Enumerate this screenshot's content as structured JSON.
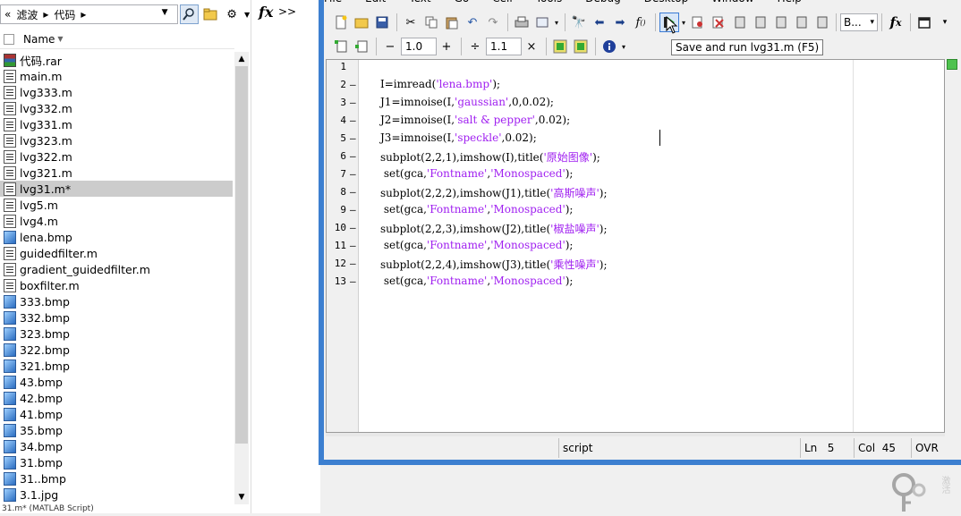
{
  "file_browser": {
    "breadcrumb": [
      "«",
      "滤波",
      "▸",
      "代码",
      "▸"
    ],
    "column_header": "Name",
    "files": [
      {
        "name": "代码.rar",
        "type": "rar"
      },
      {
        "name": "main.m",
        "type": "m"
      },
      {
        "name": "lvg333.m",
        "type": "m"
      },
      {
        "name": "lvg332.m",
        "type": "m"
      },
      {
        "name": "lvg331.m",
        "type": "m"
      },
      {
        "name": "lvg323.m",
        "type": "m"
      },
      {
        "name": "lvg322.m",
        "type": "m"
      },
      {
        "name": "lvg321.m",
        "type": "m"
      },
      {
        "name": "lvg31.m*",
        "type": "m",
        "selected": true
      },
      {
        "name": "lvg5.m",
        "type": "m"
      },
      {
        "name": "lvg4.m",
        "type": "m"
      },
      {
        "name": "lena.bmp",
        "type": "img"
      },
      {
        "name": "guidedfilter.m",
        "type": "m"
      },
      {
        "name": "gradient_guidedfilter.m",
        "type": "m"
      },
      {
        "name": "boxfilter.m",
        "type": "m"
      },
      {
        "name": "333.bmp",
        "type": "img"
      },
      {
        "name": "332.bmp",
        "type": "img"
      },
      {
        "name": "323.bmp",
        "type": "img"
      },
      {
        "name": "322.bmp",
        "type": "img"
      },
      {
        "name": "321.bmp",
        "type": "img"
      },
      {
        "name": "43.bmp",
        "type": "img"
      },
      {
        "name": "42.bmp",
        "type": "img"
      },
      {
        "name": "41.bmp",
        "type": "img"
      },
      {
        "name": "35.bmp",
        "type": "img"
      },
      {
        "name": "34.bmp",
        "type": "img"
      },
      {
        "name": "31.bmp",
        "type": "img"
      },
      {
        "name": "31..bmp",
        "type": "img"
      },
      {
        "name": "3.1.jpg",
        "type": "img"
      }
    ],
    "status": "31.m* (MATLAB Script)"
  },
  "fx_column": {
    "fx": "fx",
    "chevron": ">>"
  },
  "menu": [
    "File",
    "Edit",
    "Text",
    "Go",
    "Cell",
    "Tools",
    "Debug",
    "Desktop",
    "Window",
    "Help"
  ],
  "toolbar2": {
    "decrement": "−",
    "value1": "1.0",
    "increment": "+",
    "divide": "÷",
    "value2": "1.1",
    "close": "×"
  },
  "toolbar1": {
    "stack_combo": "B..."
  },
  "tooltip": "Save and run lvg31.m (F5)",
  "code_lines": [
    {
      "n": "1",
      "dash": "",
      "parts": []
    },
    {
      "n": "2",
      "dash": "—",
      "parts": [
        {
          "t": "I=imread("
        },
        {
          "t": "'lena.bmp'",
          "s": true
        },
        {
          "t": ");"
        }
      ]
    },
    {
      "n": "3",
      "dash": "—",
      "parts": [
        {
          "t": "J1=imnoise(I,"
        },
        {
          "t": "'gaussian'",
          "s": true
        },
        {
          "t": ",0,0.02);"
        }
      ]
    },
    {
      "n": "4",
      "dash": "—",
      "parts": [
        {
          "t": "J2=imnoise(I,"
        },
        {
          "t": "'salt & pepper'",
          "s": true
        },
        {
          "t": ",0.02);"
        }
      ]
    },
    {
      "n": "5",
      "dash": "—",
      "parts": [
        {
          "t": "J3=imnoise(I,"
        },
        {
          "t": "'speckle'",
          "s": true
        },
        {
          "t": ",0.02);"
        }
      ]
    },
    {
      "n": "6",
      "dash": "—",
      "parts": [
        {
          "t": "subplot(2,2,1),imshow(I),title("
        },
        {
          "t": "'原始图像'",
          "s": true
        },
        {
          "t": ");"
        }
      ]
    },
    {
      "n": "7",
      "dash": "—",
      "parts": [
        {
          "t": " set(gca,"
        },
        {
          "t": "'Fontname'",
          "s": true
        },
        {
          "t": ","
        },
        {
          "t": "'Monospaced'",
          "s": true
        },
        {
          "t": ");"
        }
      ]
    },
    {
      "n": "8",
      "dash": "—",
      "parts": [
        {
          "t": "subplot(2,2,2),imshow(J1),title("
        },
        {
          "t": "'高斯噪声'",
          "s": true
        },
        {
          "t": ");"
        }
      ]
    },
    {
      "n": "9",
      "dash": "—",
      "parts": [
        {
          "t": " set(gca,"
        },
        {
          "t": "'Fontname'",
          "s": true
        },
        {
          "t": ","
        },
        {
          "t": "'Monospaced'",
          "s": true
        },
        {
          "t": ");"
        }
      ]
    },
    {
      "n": "10",
      "dash": "—",
      "parts": [
        {
          "t": "subplot(2,2,3),imshow(J2),title("
        },
        {
          "t": "'椒盐噪声'",
          "s": true
        },
        {
          "t": ");"
        }
      ]
    },
    {
      "n": "11",
      "dash": "—",
      "parts": [
        {
          "t": " set(gca,"
        },
        {
          "t": "'Fontname'",
          "s": true
        },
        {
          "t": ","
        },
        {
          "t": "'Monospaced'",
          "s": true
        },
        {
          "t": ");"
        }
      ]
    },
    {
      "n": "12",
      "dash": "—",
      "parts": [
        {
          "t": "subplot(2,2,4),imshow(J3),title("
        },
        {
          "t": "'乘性噪声'",
          "s": true
        },
        {
          "t": ");"
        }
      ]
    },
    {
      "n": "13",
      "dash": "—",
      "parts": [
        {
          "t": " set(gca,"
        },
        {
          "t": "'Fontname'",
          "s": true
        },
        {
          "t": ","
        },
        {
          "t": "'Monospaced'",
          "s": true
        },
        {
          "t": ");"
        }
      ]
    }
  ],
  "status_bar": {
    "mode": "script",
    "ln_label": "Ln",
    "ln": "5",
    "col_label": "Col",
    "col": "45",
    "ovr": "OVR"
  },
  "colors": {
    "string": "#a020f0",
    "window_frame": "#3c7fd0",
    "selection": "#cccccc"
  },
  "watermark_text": "激活"
}
